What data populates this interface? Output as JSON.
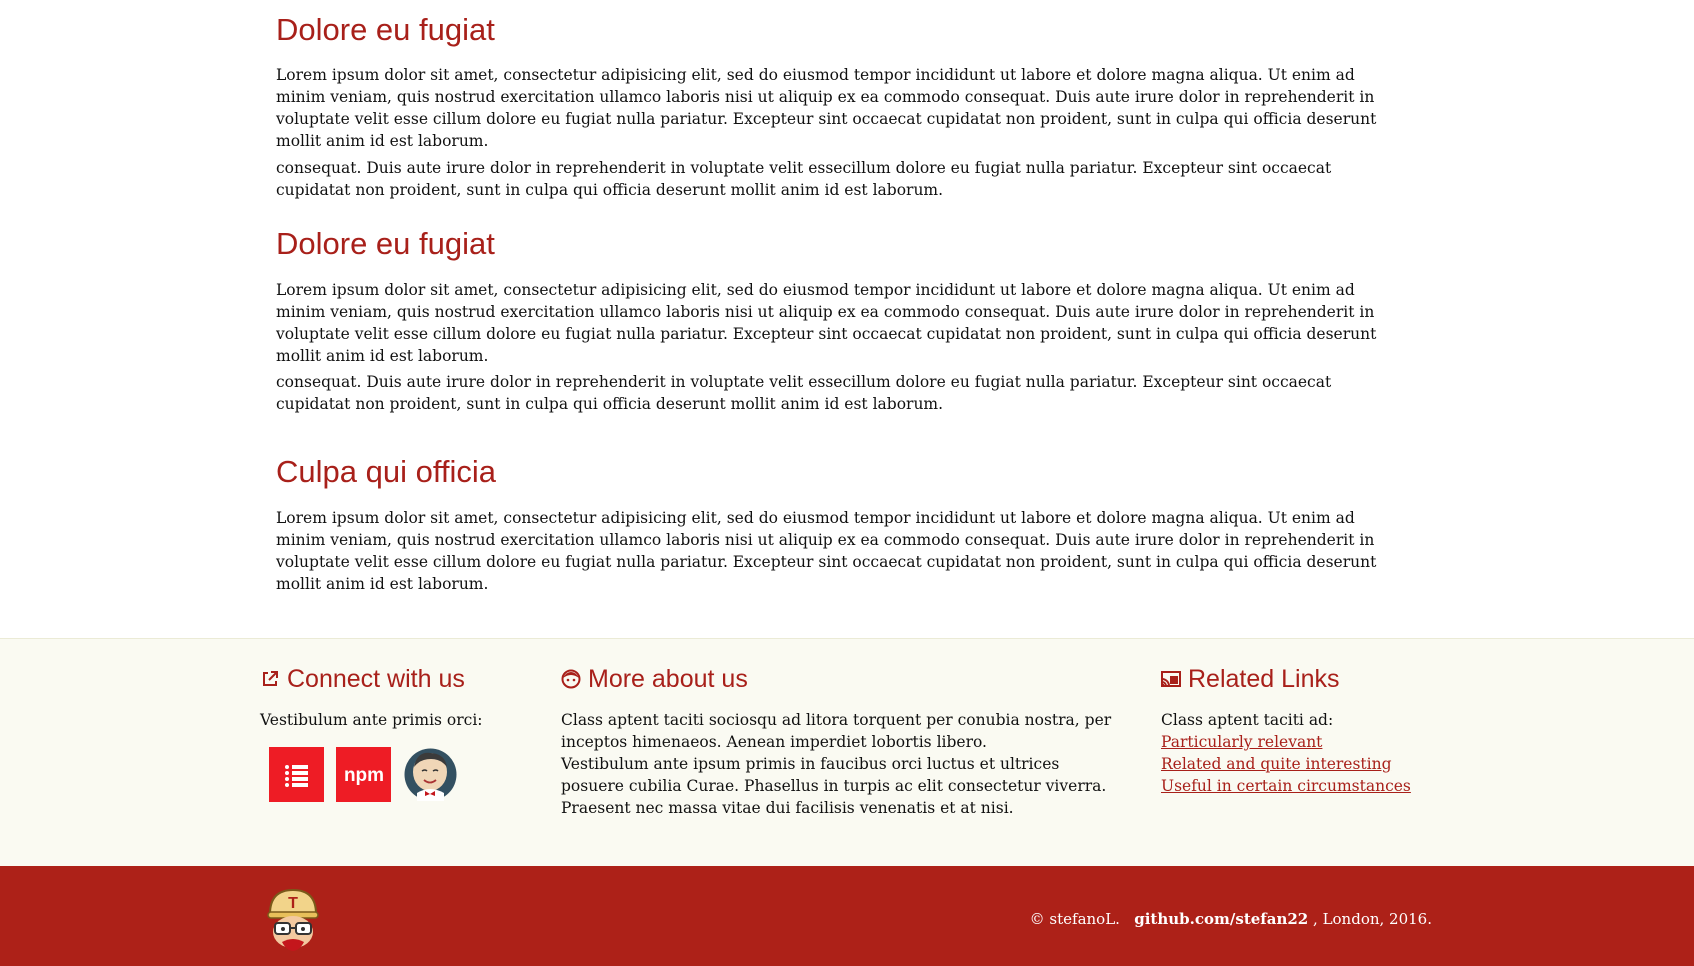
{
  "sections": [
    {
      "title": "Dolore eu fugiat",
      "paragraphs": [
        "Lorem ipsum dolor sit amet, consectetur adipisicing elit, sed do eiusmod tempor incididunt ut labore et dolore magna aliqua. Ut enim ad minim veniam, quis nostrud exercitation ullamco laboris nisi ut aliquip ex ea commodo consequat. Duis aute irure dolor in reprehenderit in voluptate velit esse cillum dolore eu fugiat nulla pariatur. Excepteur sint occaecat cupidatat non proident, sunt in culpa qui officia deserunt mollit anim id est laborum.",
        "consequat. Duis aute irure dolor in reprehenderit in voluptate velit essecillum dolore eu fugiat nulla pariatur. Excepteur sint occaecat cupidatat non proident, sunt in culpa qui officia deserunt mollit anim id est laborum."
      ]
    },
    {
      "title": "Dolore eu fugiat",
      "paragraphs": [
        "Lorem ipsum dolor sit amet, consectetur adipisicing elit, sed do eiusmod tempor incididunt ut labore et dolore magna aliqua. Ut enim ad minim veniam, quis nostrud exercitation ullamco laboris nisi ut aliquip ex ea commodo consequat. Duis aute irure dolor in reprehenderit in voluptate velit esse cillum dolore eu fugiat nulla pariatur. Excepteur sint occaecat cupidatat non proident, sunt in culpa qui officia deserunt mollit anim id est laborum.",
        "consequat. Duis aute irure dolor in reprehenderit in voluptate velit essecillum dolore eu fugiat nulla pariatur. Excepteur sint occaecat cupidatat non proident, sunt in culpa qui officia deserunt mollit anim id est laborum."
      ]
    },
    {
      "title": "Culpa qui officia",
      "paragraphs": [
        "Lorem ipsum dolor sit amet, consectetur adipisicing elit, sed do eiusmod tempor incididunt ut labore et dolore magna aliqua. Ut enim ad minim veniam, quis nostrud exercitation ullamco laboris nisi ut aliquip ex ea commodo consequat. Duis aute irure dolor in reprehenderit in voluptate velit esse cillum dolore eu fugiat nulla pariatur. Excepteur sint occaecat cupidatat non proident, sunt in culpa qui officia deserunt mollit anim id est laborum."
      ]
    }
  ],
  "footer": {
    "connect": {
      "title": "Connect with us",
      "icon": "external-link-icon",
      "lead": "Vestibulum ante primis orci:",
      "social": [
        {
          "name": "list-app-icon",
          "label": "list"
        },
        {
          "name": "npm-icon",
          "label": "npm"
        },
        {
          "name": "jenkins-icon",
          "label": "jenkins"
        }
      ]
    },
    "about": {
      "title": "More about us",
      "icon": "face-icon",
      "p1": "Class aptent taciti sociosqu ad litora torquent per conubia nostra, per inceptos himenaeos. Aenean imperdiet lobortis libero.",
      "p2": "Vestibulum ante ipsum primis in faucibus orci luctus et ultrices posuere cubilia Curae. Phasellus in turpis ac elit consectetur viverra. Praesent nec massa vitae dui facilisis venenatis et at nisi."
    },
    "related": {
      "title": "Related Links",
      "icon": "cast-icon",
      "lead": "Class aptent taciti ad:",
      "links": [
        "Particularly relevant",
        "Related and quite interesting",
        "Useful in certain circumstances"
      ]
    }
  },
  "bottom": {
    "copyright_prefix": "© stefanoL.",
    "github_link": "github.com/stefan22",
    "copyright_suffix": ", London, 2016.",
    "npm_text": "npm",
    "mascot_letter": "T"
  },
  "colors": {
    "heading_red": "#a8201a",
    "footer_bg": "#fafaf2",
    "bottom_bar": "#ad2118",
    "icon_red": "#ee1c25"
  }
}
